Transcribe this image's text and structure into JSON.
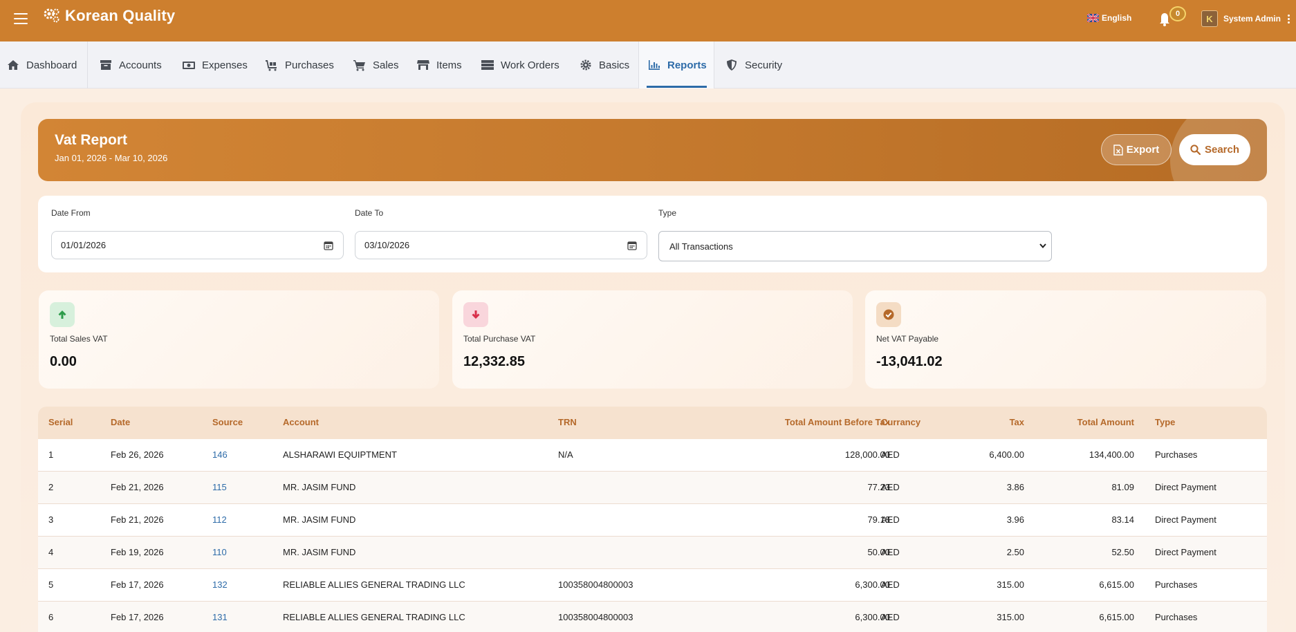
{
  "app": {
    "title": "Korean Quality"
  },
  "topbar": {
    "language": "English",
    "notifications_count": "0",
    "user_name": "System Admin",
    "avatar_letter": "K"
  },
  "nav": {
    "items": [
      {
        "label": "Dashboard",
        "icon": "home-icon"
      },
      {
        "label": "Accounts",
        "icon": "archive-icon"
      },
      {
        "label": "Expenses",
        "icon": "money-icon"
      },
      {
        "label": "Purchases",
        "icon": "cart-flatbed-icon"
      },
      {
        "label": "Sales",
        "icon": "shopping-cart-icon"
      },
      {
        "label": "Items",
        "icon": "store-icon"
      },
      {
        "label": "Work Orders",
        "icon": "server-icon"
      },
      {
        "label": "Basics",
        "icon": "gear-icon"
      },
      {
        "label": "Reports",
        "icon": "bar-chart-icon",
        "active": true
      },
      {
        "label": "Security",
        "icon": "shield-icon"
      }
    ]
  },
  "report": {
    "title": "Vat Report",
    "range": "Jan 01, 2026 - Mar 10, 2026",
    "export_label": "Export",
    "search_label": "Search"
  },
  "filters": {
    "date_from_label": "Date From",
    "date_from_value": "01/01/2026",
    "date_to_label": "Date To",
    "date_to_value": "03/10/2026",
    "type_label": "Type",
    "type_value": "All Transactions"
  },
  "stats": [
    {
      "label": "Total Sales VAT",
      "value": "0.00",
      "icon": "arrow-up-icon",
      "color": "#2e9c4b",
      "bg": "#d7f0dc"
    },
    {
      "label": "Total Purchase VAT",
      "value": "12,332.85",
      "icon": "arrow-down-icon",
      "color": "#d8304a",
      "bg": "#f9d6dc"
    },
    {
      "label": "Net VAT Payable",
      "value": "-13,041.02",
      "icon": "check-circle-icon",
      "color": "#b5692a",
      "bg": "#f4dcc4"
    }
  ],
  "table": {
    "headers": {
      "serial": "Serial",
      "date": "Date",
      "source": "Source",
      "account": "Account",
      "trn": "TRN",
      "before_tax": "Total Amount Before Tax",
      "currency": "Currancy",
      "tax": "Tax",
      "total": "Total Amount",
      "type": "Type"
    },
    "rows": [
      {
        "serial": "1",
        "date": "Feb 26, 2026",
        "source": "146",
        "account": "ALSHARAWI EQUIPTMENT",
        "trn": "N/A",
        "before_tax": "128,000.00",
        "currency": "AED",
        "tax": "6,400.00",
        "total": "134,400.00",
        "type": "Purchases"
      },
      {
        "serial": "2",
        "date": "Feb 21, 2026",
        "source": "115",
        "account": "MR. JASIM FUND",
        "trn": "",
        "before_tax": "77.23",
        "currency": "AED",
        "tax": "3.86",
        "total": "81.09",
        "type": "Direct Payment"
      },
      {
        "serial": "3",
        "date": "Feb 21, 2026",
        "source": "112",
        "account": "MR. JASIM FUND",
        "trn": "",
        "before_tax": "79.18",
        "currency": "AED",
        "tax": "3.96",
        "total": "83.14",
        "type": "Direct Payment"
      },
      {
        "serial": "4",
        "date": "Feb 19, 2026",
        "source": "110",
        "account": "MR. JASIM FUND",
        "trn": "",
        "before_tax": "50.00",
        "currency": "AED",
        "tax": "2.50",
        "total": "52.50",
        "type": "Direct Payment"
      },
      {
        "serial": "5",
        "date": "Feb 17, 2026",
        "source": "132",
        "account": "RELIABLE ALLIES GENERAL TRADING LLC",
        "trn": "100358004800003",
        "before_tax": "6,300.00",
        "currency": "AED",
        "tax": "315.00",
        "total": "6,615.00",
        "type": "Purchases"
      },
      {
        "serial": "6",
        "date": "Feb 17, 2026",
        "source": "131",
        "account": "RELIABLE ALLIES GENERAL TRADING LLC",
        "trn": "100358004800003",
        "before_tax": "6,300.00",
        "currency": "AED",
        "tax": "315.00",
        "total": "6,615.00",
        "type": "Purchases"
      }
    ]
  },
  "colors": {
    "brand": "#cd7f2e",
    "accent_link": "#2d6ba8",
    "header_text": "#b5692a"
  }
}
